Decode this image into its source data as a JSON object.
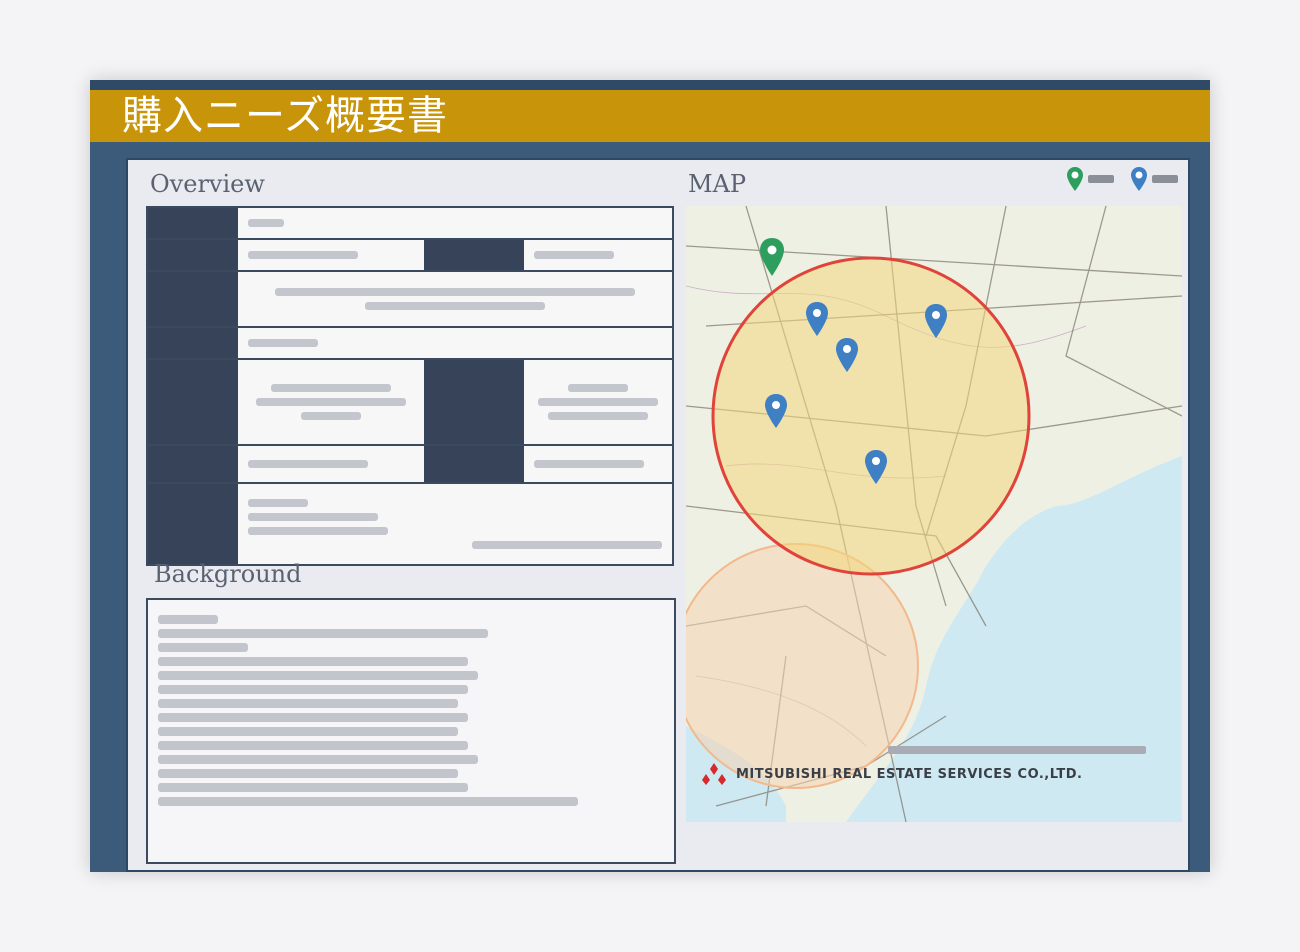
{
  "title": "購入ニーズ概要書",
  "date": "",
  "sections": {
    "overview": "Overview",
    "background": "Background",
    "map": "MAP"
  },
  "overview_rows": [
    {
      "label": "",
      "value": ""
    },
    {
      "label": "",
      "value": "",
      "label2": "",
      "value2": ""
    },
    {
      "label": "",
      "value": ""
    },
    {
      "label": "",
      "value": ""
    },
    {
      "label": "",
      "value": "",
      "label2": "",
      "value2": ""
    },
    {
      "label": "",
      "value": "",
      "label2": "",
      "value2": ""
    },
    {
      "label": "",
      "value": ""
    }
  ],
  "background_text": [],
  "map": {
    "legend": [
      {
        "icon": "green-pin-icon",
        "color": "#2e9e5e",
        "label": ""
      },
      {
        "icon": "blue-pin-icon",
        "color": "#3f7fc4",
        "label": ""
      }
    ],
    "circle_colors": {
      "primary_fill": "#f3d77a",
      "primary_stroke": "#e0433a",
      "secondary_fill": "#f6d3b0"
    },
    "credit": ""
  },
  "company": "MITSUBISHI REAL ESTATE SERVICES CO.,LTD.",
  "colors": {
    "title_bar": "#c8940a",
    "frame": "#3c5a7a",
    "label_bg": "#364358"
  }
}
